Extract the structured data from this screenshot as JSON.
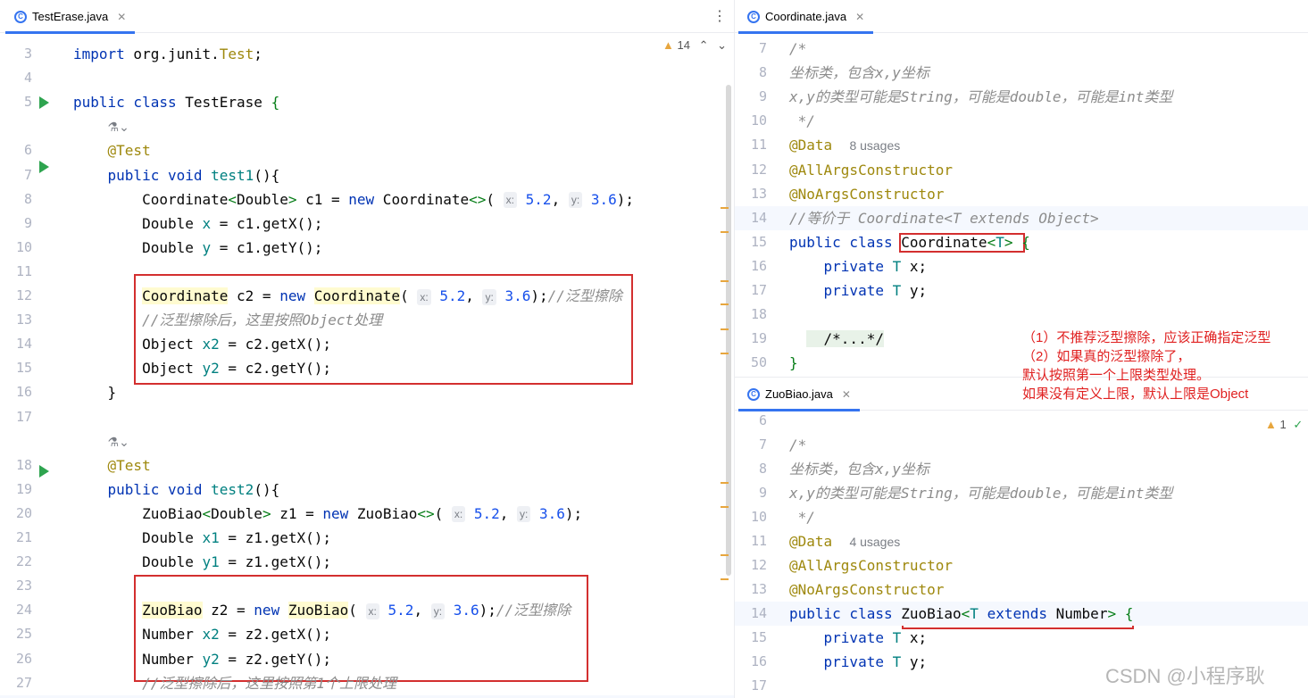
{
  "left": {
    "tab": "TestErase.java",
    "warnings": "14",
    "lines": [
      {
        "n": "3",
        "html": "<span class='kw'>import</span> org.junit.<span class='ann'>Test</span>;"
      },
      {
        "n": "4",
        "html": ""
      },
      {
        "n": "5",
        "html": "<span class='kw'>public class</span> TestErase <span class='str'>{</span>"
      },
      {
        "n": "",
        "html": "    <span class='usage'>⚗</span><span class='usage'>⌄</span>"
      },
      {
        "n": "6",
        "html": "    <span class='ann'>@Test</span>"
      },
      {
        "n": "7",
        "html": "    <span class='kw'>public void</span> <span class='typ'>test1</span>(){"
      },
      {
        "n": "8",
        "html": "        Coordinate<span class='str'>&lt;</span>Double<span class='str'>&gt;</span> c1 = <span class='kw'>new</span> Coordinate<span class='str'>&lt;&gt;</span>( <span class='hint'>x:</span> <span class='num'>5.2</span>, <span class='hint'>y:</span> <span class='num'>3.6</span>);"
      },
      {
        "n": "9",
        "html": "        Double <span class='typ'>x</span> = c1.getX();"
      },
      {
        "n": "10",
        "html": "        Double <span class='typ'>y</span> = c1.getY();"
      },
      {
        "n": "11",
        "html": ""
      },
      {
        "n": "12",
        "html": "        <span class='hl'>Coordinate</span> c2 = <span class='kw'>new</span> <span class='hl'>Coordinate</span>( <span class='hint'>x:</span> <span class='num'>5.2</span>, <span class='hint'>y:</span> <span class='num'>3.6</span>);<span class='cmt'>//泛型擦除</span>"
      },
      {
        "n": "13",
        "html": "        <span class='cmt'>//泛型擦除后，这里按照Object处理</span>"
      },
      {
        "n": "14",
        "html": "        Object <span class='typ'>x2</span> = c2.getX();"
      },
      {
        "n": "15",
        "html": "        Object <span class='typ'>y2</span> = c2.getY();"
      },
      {
        "n": "16",
        "html": "    }"
      },
      {
        "n": "17",
        "html": ""
      },
      {
        "n": "",
        "html": "    <span class='usage'>⚗</span><span class='usage'>⌄</span>"
      },
      {
        "n": "18",
        "html": "    <span class='ann'>@Test</span>"
      },
      {
        "n": "19",
        "html": "    <span class='kw'>public void</span> <span class='typ'>test2</span>(){"
      },
      {
        "n": "20",
        "html": "        ZuoBiao<span class='str'>&lt;</span>Double<span class='str'>&gt;</span> z1 = <span class='kw'>new</span> ZuoBiao<span class='str'>&lt;&gt;</span>( <span class='hint'>x:</span> <span class='num'>5.2</span>, <span class='hint'>y:</span> <span class='num'>3.6</span>);"
      },
      {
        "n": "21",
        "html": "        Double <span class='typ'>x1</span> = z1.getX();"
      },
      {
        "n": "22",
        "html": "        Double <span class='typ'>y1</span> = z1.getX();"
      },
      {
        "n": "23",
        "html": ""
      },
      {
        "n": "24",
        "html": "        <span class='hl'>ZuoBiao</span> z2 = <span class='kw'>new</span> <span class='hl'>ZuoBiao</span>( <span class='hint'>x:</span> <span class='num'>5.2</span>, <span class='hint'>y:</span> <span class='num'>3.6</span>);<span class='cmt'>//泛型擦除</span>"
      },
      {
        "n": "25",
        "html": "        Number <span class='typ'>x2</span> = z2.getX();"
      },
      {
        "n": "26",
        "html": "        Number <span class='typ'>y2</span> = z2.getY();"
      },
      {
        "n": "27",
        "html": "        <span class='cmt'>//泛型擦除后，这里按照第1个上限处理</span>"
      },
      {
        "n": "28",
        "html": "    }"
      }
    ]
  },
  "topRight": {
    "tab": "Coordinate.java",
    "lines": [
      {
        "n": "7",
        "html": "<span class='cmt'>/*</span>"
      },
      {
        "n": "8",
        "html": "<span class='cmt'>坐标类，包含x,y坐标</span>"
      },
      {
        "n": "9",
        "html": "<span class='cmt'>x,y的类型可能是String，可能是double，可能是int类型</span>"
      },
      {
        "n": "10",
        "html": "<span class='cmt'> */</span>"
      },
      {
        "n": "11",
        "html": "<span class='ann'>@Data</span>  <span class='usage'>8 usages</span>"
      },
      {
        "n": "12",
        "html": "<span class='ann'>@AllArgsConstructor</span>"
      },
      {
        "n": "13",
        "html": "<span class='ann'>@NoArgsConstructor</span>"
      },
      {
        "n": "14",
        "html": "<span class='cmt'>//等价于 Coordinate&lt;T extends Object&gt;</span>"
      },
      {
        "n": "15",
        "html": "<span class='kw'>public class</span> Coordinate<span class='str'>&lt;</span><span class='typ'>T</span><span class='str'>&gt;</span> <span class='str'>{</span>"
      },
      {
        "n": "16",
        "html": "    <span class='kw'>private</span> <span class='typ'>T</span> x;"
      },
      {
        "n": "17",
        "html": "    <span class='kw'>private</span> <span class='typ'>T</span> y;"
      },
      {
        "n": "18",
        "html": ""
      },
      {
        "n": "19",
        "html": "  <span class='fold'>  /*...*/</span>"
      },
      {
        "n": "50",
        "html": "<span class='str'>}</span>"
      }
    ]
  },
  "bottomRight": {
    "tab": "ZuoBiao.java",
    "warnings": "1",
    "lines": [
      {
        "n": "6",
        "html": ""
      },
      {
        "n": "7",
        "html": "<span class='cmt'>/*</span>"
      },
      {
        "n": "8",
        "html": "<span class='cmt'>坐标类，包含x,y坐标</span>"
      },
      {
        "n": "9",
        "html": "<span class='cmt'>x,y的类型可能是String，可能是double，可能是int类型</span>"
      },
      {
        "n": "10",
        "html": "<span class='cmt'> */</span>"
      },
      {
        "n": "11",
        "html": "<span class='ann'>@Data</span>  <span class='usage'>4 usages</span>"
      },
      {
        "n": "12",
        "html": "<span class='ann'>@AllArgsConstructor</span>"
      },
      {
        "n": "13",
        "html": "<span class='ann'>@NoArgsConstructor</span>"
      },
      {
        "n": "14",
        "html": "<span class='kw'>public class</span> ZuoBiao<span class='str'>&lt;</span><span class='typ'>T</span> <span class='kw'>extends</span> Number<span class='str'>&gt;</span> <span class='str'>{</span>"
      },
      {
        "n": "15",
        "html": "    <span class='kw'>private</span> <span class='typ'>T</span> x;"
      },
      {
        "n": "16",
        "html": "    <span class='kw'>private</span> <span class='typ'>T</span> y;"
      },
      {
        "n": "17",
        "html": ""
      }
    ]
  },
  "annotation": "（1）不推荐泛型擦除，应该正确指定泛型\n（2）如果真的泛型擦除了，\n默认按照第一个上限类型处理。\n如果没有定义上限，默认上限是Object",
  "watermark": "CSDN @小程序耿",
  "colors": {
    "accent": "#3574f0",
    "red": "#d32f2f"
  }
}
